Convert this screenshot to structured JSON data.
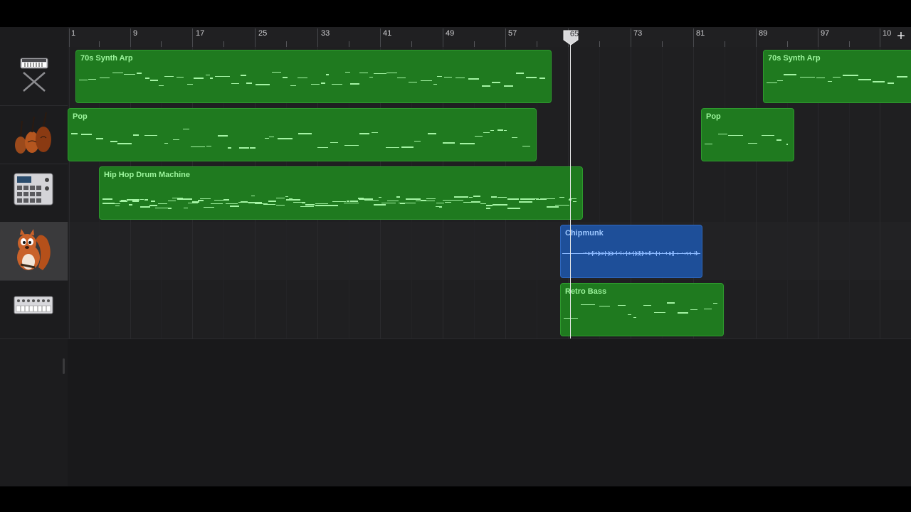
{
  "ruler": {
    "bar_labels": [
      "1",
      "9",
      "17",
      "25",
      "33",
      "41",
      "49",
      "57",
      "65",
      "73",
      "81",
      "89",
      "97",
      "10"
    ],
    "add_track_symbol": "+"
  },
  "playhead": {
    "bar": "65"
  },
  "tracks": [
    {
      "name": "70s Synth Arp",
      "icon": "synth-keyboard-icon",
      "selected": false
    },
    {
      "name": "Pop",
      "icon": "string-ensemble-icon",
      "selected": false
    },
    {
      "name": "Hip Hop Drum Machine",
      "icon": "drum-machine-icon",
      "selected": false
    },
    {
      "name": "Chipmunk",
      "icon": "chipmunk-icon",
      "selected": true
    },
    {
      "name": "Retro Bass",
      "icon": "bass-synth-module-icon",
      "selected": false
    }
  ],
  "regions": [
    {
      "track": 0,
      "name": "70s Synth Arp",
      "type": "midi"
    },
    {
      "track": 0,
      "name": "70s Synth Arp",
      "type": "midi"
    },
    {
      "track": 1,
      "name": "Pop",
      "type": "midi"
    },
    {
      "track": 1,
      "name": "Pop",
      "type": "midi"
    },
    {
      "track": 2,
      "name": "Hip Hop Drum Machine",
      "type": "midi"
    },
    {
      "track": 3,
      "name": "Chipmunk",
      "type": "audio"
    },
    {
      "track": 4,
      "name": "Retro Bass",
      "type": "midi"
    }
  ],
  "colors": {
    "midi_region": "#1f7a1f",
    "audio_region": "#1e4f99",
    "midi_notes": "#a4f4a4",
    "audio_wave": "#8ab8ff",
    "background": "#1c1c1e"
  }
}
